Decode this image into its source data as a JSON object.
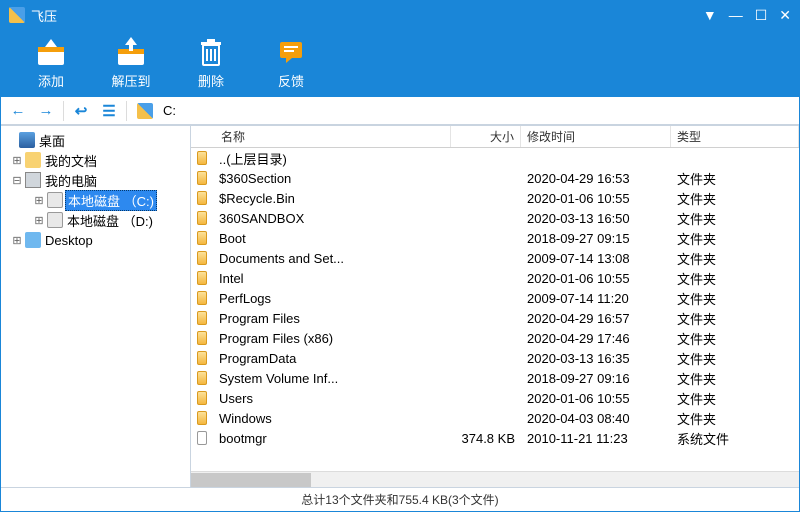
{
  "window": {
    "title": "飞压"
  },
  "toolbar": {
    "add": "添加",
    "extract": "解压到",
    "delete": "删除",
    "feedback": "反馈"
  },
  "address": "C:",
  "tree": {
    "root": "桌面",
    "mydocs": "我的文档",
    "mycomputer": "我的电脑",
    "drive_c": "本地磁盘 （C:)",
    "drive_d": "本地磁盘 （D:)",
    "desktop": "Desktop"
  },
  "columns": {
    "name": "名称",
    "size": "大小",
    "date": "修改时间",
    "type": "类型"
  },
  "files": [
    {
      "icon": "folder",
      "name": "..(上层目录)",
      "size": "",
      "date": "",
      "type": ""
    },
    {
      "icon": "folder",
      "name": "$360Section",
      "size": "",
      "date": "2020-04-29 16:53",
      "type": "文件夹"
    },
    {
      "icon": "folder",
      "name": "$Recycle.Bin",
      "size": "",
      "date": "2020-01-06 10:55",
      "type": "文件夹"
    },
    {
      "icon": "folder",
      "name": "360SANDBOX",
      "size": "",
      "date": "2020-03-13 16:50",
      "type": "文件夹"
    },
    {
      "icon": "folder",
      "name": "Boot",
      "size": "",
      "date": "2018-09-27 09:15",
      "type": "文件夹"
    },
    {
      "icon": "folder",
      "name": "Documents and Set...",
      "size": "",
      "date": "2009-07-14 13:08",
      "type": "文件夹"
    },
    {
      "icon": "folder",
      "name": "Intel",
      "size": "",
      "date": "2020-01-06 10:55",
      "type": "文件夹"
    },
    {
      "icon": "folder",
      "name": "PerfLogs",
      "size": "",
      "date": "2009-07-14 11:20",
      "type": "文件夹"
    },
    {
      "icon": "folder",
      "name": "Program Files",
      "size": "",
      "date": "2020-04-29 16:57",
      "type": "文件夹"
    },
    {
      "icon": "folder",
      "name": "Program Files (x86)",
      "size": "",
      "date": "2020-04-29 17:46",
      "type": "文件夹"
    },
    {
      "icon": "folder",
      "name": "ProgramData",
      "size": "",
      "date": "2020-03-13 16:35",
      "type": "文件夹"
    },
    {
      "icon": "folder",
      "name": "System Volume Inf...",
      "size": "",
      "date": "2018-09-27 09:16",
      "type": "文件夹"
    },
    {
      "icon": "folder",
      "name": "Users",
      "size": "",
      "date": "2020-01-06 10:55",
      "type": "文件夹"
    },
    {
      "icon": "folder",
      "name": "Windows",
      "size": "",
      "date": "2020-04-03 08:40",
      "type": "文件夹"
    },
    {
      "icon": "file",
      "name": "bootmgr",
      "size": "374.8 KB",
      "date": "2010-11-21 11:23",
      "type": "系统文件"
    }
  ],
  "status": "总计13个文件夹和755.4 KB(3个文件)"
}
